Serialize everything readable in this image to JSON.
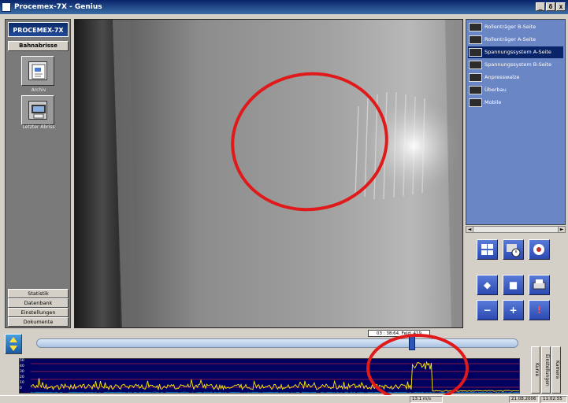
{
  "window": {
    "title": "Procemex-7X - Genius",
    "controls": [
      "_",
      "δ",
      "x"
    ]
  },
  "sidebar": {
    "logo": "PROCEMEX-7X",
    "group_title": "Bahnabrisse",
    "big_buttons": [
      {
        "label": "Archiv",
        "icon": "document-chart-icon"
      },
      {
        "label": "Letzter Abriss",
        "icon": "printer-screen-icon"
      }
    ],
    "nav": [
      "Statistik",
      "Datenbank",
      "Einstellungen",
      "Dokumente"
    ]
  },
  "cameras": {
    "items": [
      {
        "label": "Rollenträger B-Seite",
        "selected": false
      },
      {
        "label": "Rollenträger A-Seite",
        "selected": false
      },
      {
        "label": "Spannungssystem A-Seite",
        "selected": true
      },
      {
        "label": "Spannungssystem B-Seite",
        "selected": false
      },
      {
        "label": "Anpresswalze",
        "selected": false
      },
      {
        "label": "Überbau",
        "selected": false
      },
      {
        "label": "Mobile",
        "selected": false
      }
    ],
    "scroll_left": "◄",
    "scroll_right": "►"
  },
  "controls": {
    "row1": [
      "grid-view-icon",
      "time-dial-icon",
      "camera-settings-icon"
    ],
    "row2": [
      "split-view-icon",
      "stop-icon",
      "print-icon"
    ],
    "row3": [
      "minus-icon",
      "plus-icon",
      "marker-icon"
    ],
    "symbols": {
      "minus": "−",
      "plus": "+",
      "marker": "!",
      "stop": "■",
      "split": "◆"
    }
  },
  "timeline": {
    "tooltip": "03 : 38:64, Feld: 419",
    "thumb_position": 0.779
  },
  "graph": {
    "y_ticks": [
      "50",
      "40",
      "30",
      "20",
      "10",
      "0"
    ],
    "colors": {
      "background": "#000060",
      "signal": "#ffee00",
      "threshold": "#ff3030"
    }
  },
  "tabs": [
    "Kurve",
    "Einstellungen",
    "Kamera"
  ],
  "status": {
    "cells": [
      "13.1 m/s",
      "21.08.2006",
      "11:02:55"
    ]
  },
  "annotations": {
    "color": "#e01a1a"
  }
}
